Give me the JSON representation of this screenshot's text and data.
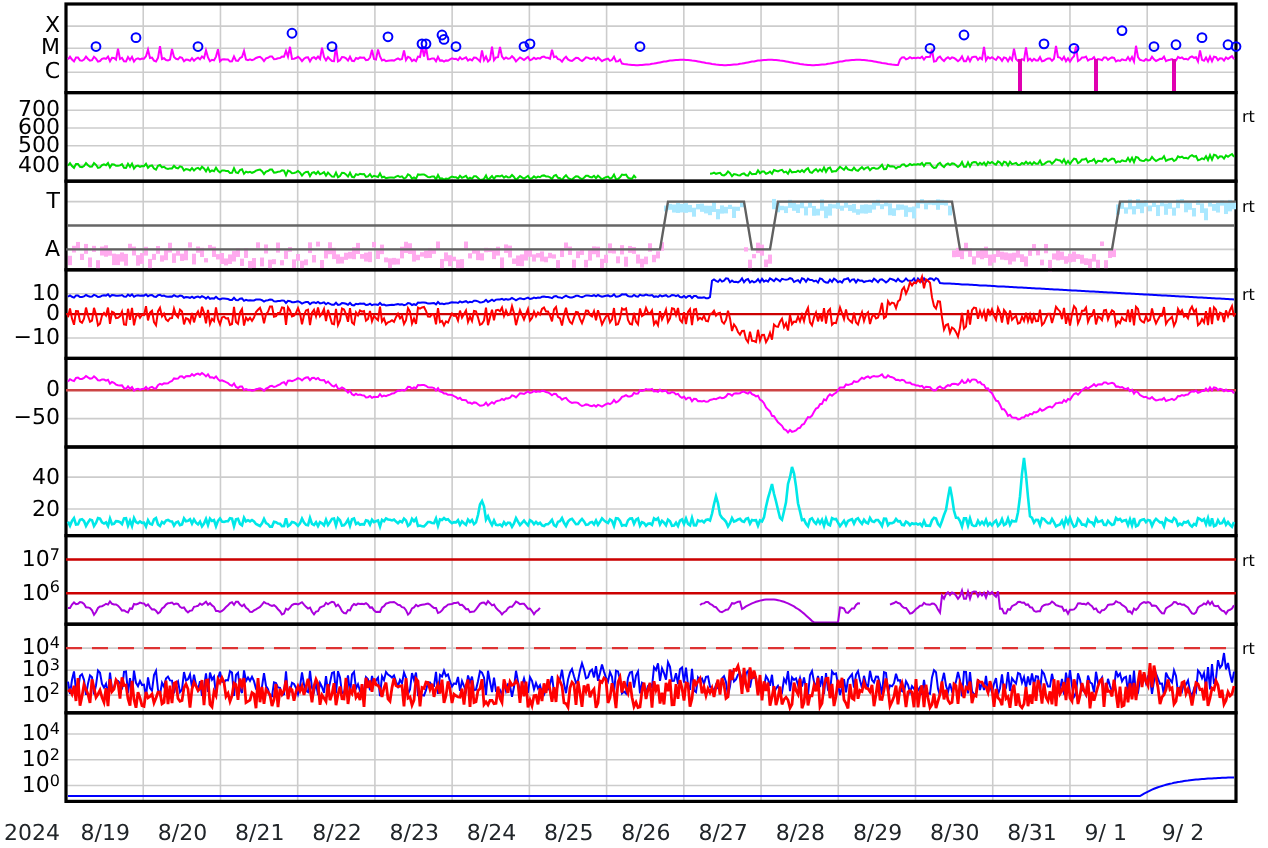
{
  "panels": [
    {
      "kind": "xray",
      "ticks": [
        "X",
        "M",
        "C"
      ]
    },
    {
      "kind": "wind",
      "ticks": [
        "700",
        "600",
        "500",
        "400"
      ],
      "side_label": "rt"
    },
    {
      "kind": "sector",
      "ticks": [
        "T",
        "A"
      ],
      "side_label": "rt"
    },
    {
      "kind": "field",
      "ticks": [
        "10",
        "0",
        "−10"
      ],
      "side_label": "rt"
    },
    {
      "kind": "dst",
      "ticks": [
        "0",
        "−50"
      ]
    },
    {
      "kind": "index",
      "ticks": [
        "40",
        "20"
      ]
    },
    {
      "kind": "electron",
      "ticks": [
        "10$^{7}$",
        "10$^{6}$"
      ],
      "side_label": "rt"
    },
    {
      "kind": "proton",
      "ticks": [
        "10$^{4}$",
        "10$^{3}$",
        "10$^{2}$"
      ],
      "side_label": "rt"
    },
    {
      "kind": "flux",
      "ticks": [
        "10$^{4}$",
        "10$^{2}$",
        "10$^{0}$"
      ]
    }
  ],
  "x_axis": {
    "year": "2024",
    "labels": [
      "8/19",
      "8/20",
      "8/21",
      "8/22",
      "8/23",
      "8/24",
      "8/25",
      "8/26",
      "8/27",
      "8/28",
      "8/29",
      "8/30",
      "8/31",
      "9/ 1",
      "9/ 2"
    ]
  }
}
